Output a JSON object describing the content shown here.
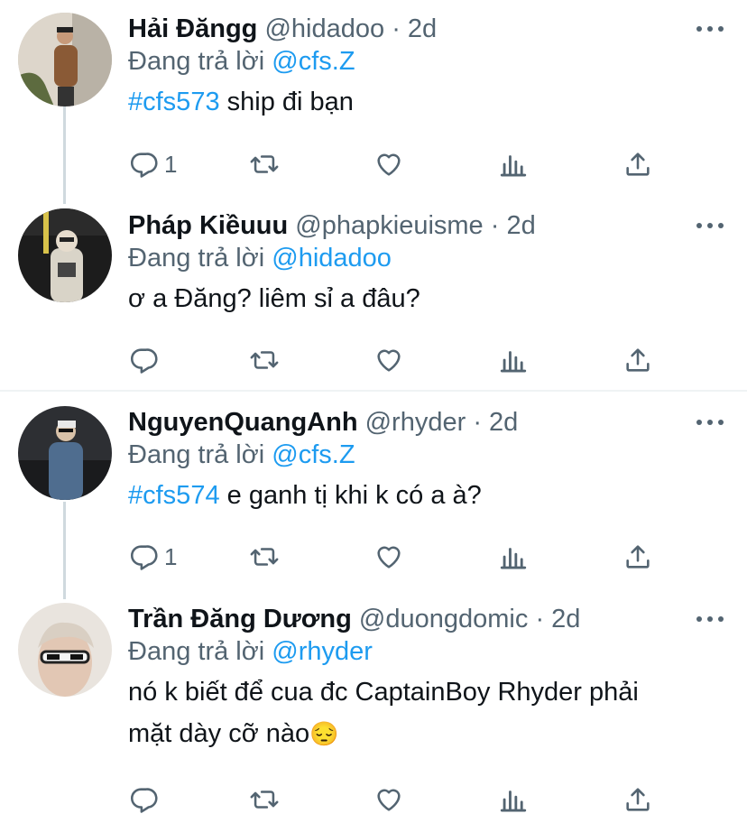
{
  "tweets": [
    {
      "name": "Hải Đăngg",
      "handle": "@hidadoo",
      "time": "· 2d",
      "reply_prefix": "Đang trả lời",
      "reply_to": "@cfs.Z",
      "hashtag": "#cfs573",
      "text": " ship đi bạn",
      "reply_count": "1"
    },
    {
      "name": "Pháp Kiềuuu",
      "handle": "@phapkieuisme",
      "time": "· 2d",
      "reply_prefix": "Đang trả lời",
      "reply_to": "@hidadoo",
      "text": "ơ a Đăng? liêm sỉ a đâu?"
    },
    {
      "name": "NguyenQuangAnh",
      "handle": "@rhyder",
      "time": "· 2d",
      "reply_prefix": "Đang trả lời",
      "reply_to": "@cfs.Z",
      "hashtag": "#cfs574",
      "text": " e ganh tị khi k có a à?",
      "reply_count": "1"
    },
    {
      "name": "Trần Đăng Dương",
      "handle": "@duongdomic",
      "time": "· 2d",
      "reply_prefix": "Đang trả lời",
      "reply_to": "@rhyder",
      "text_line1": "nó k biết để cua đc CaptainBoy Rhyder phải",
      "text_line2": "mặt dày cỡ nào",
      "emoji": "😔"
    }
  ],
  "icons": {
    "reply": "reply-icon",
    "retweet": "retweet-icon",
    "like": "heart-icon",
    "analytics": "analytics-icon",
    "share": "share-icon",
    "more": "more-icon"
  },
  "colors": {
    "link": "#1d9bf0",
    "muted": "#536471",
    "text": "#0f1419",
    "thread_line": "#cfd9de"
  }
}
